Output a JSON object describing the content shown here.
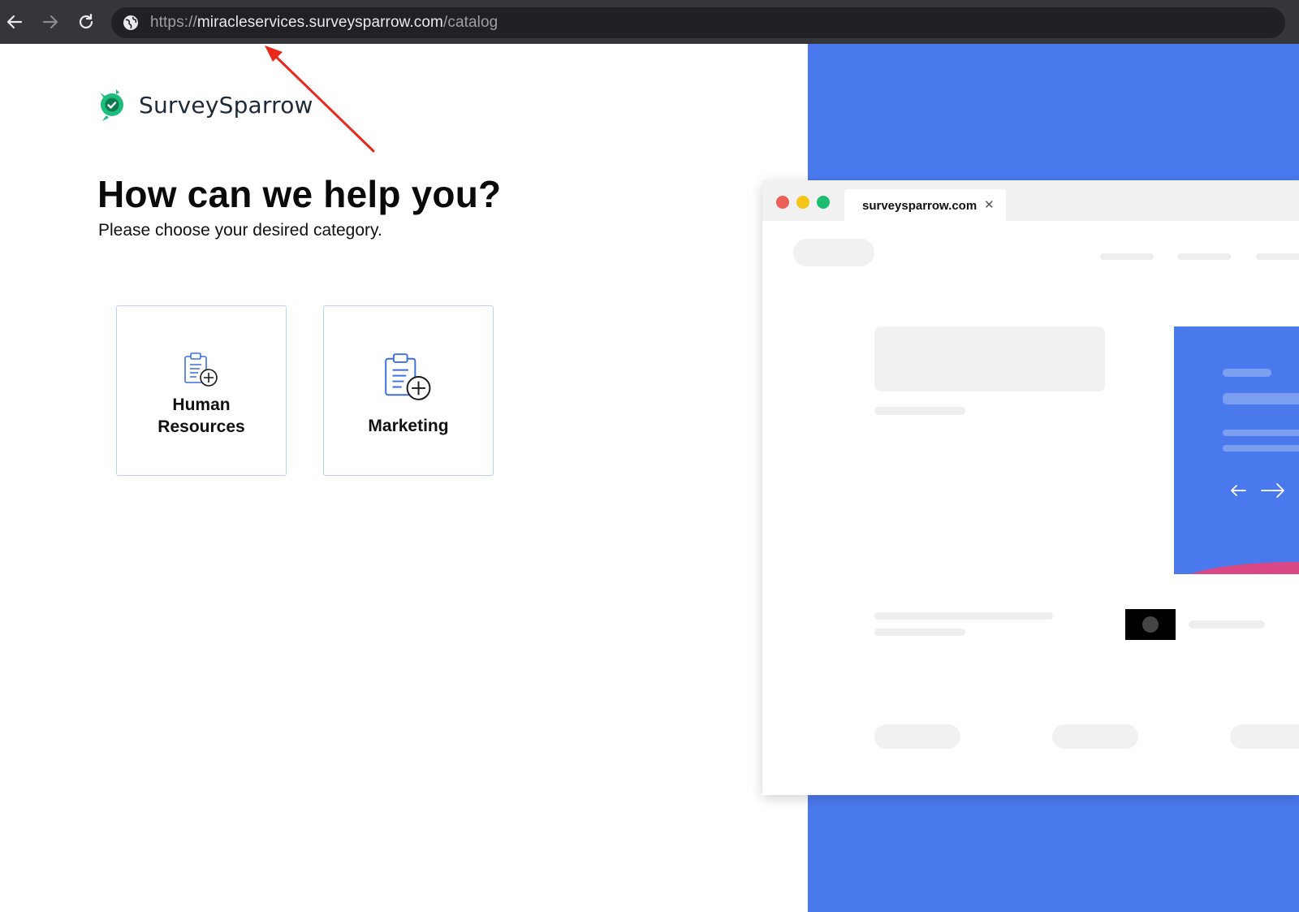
{
  "browser": {
    "url_scheme": "https://",
    "url_host": "miracleservices.surveysparrow.com",
    "url_path": "/catalog"
  },
  "brand": {
    "name": "SurveySparrow",
    "logo_color": "#1dbd7e"
  },
  "page": {
    "heading": "How can we help you?",
    "subheading": "Please choose your desired category."
  },
  "categories": [
    {
      "line1": "Human",
      "line2": "Resources",
      "icon": "clipboard-plus-icon"
    },
    {
      "line1": "Marketing",
      "line2": "",
      "icon": "clipboard-plus-icon"
    }
  ],
  "illustration": {
    "tab_title": "surveysparrow.com",
    "accent_blue": "#4a79ee",
    "accent_pink": "#d94785"
  },
  "annotation": {
    "arrow_color": "#e8291c"
  }
}
